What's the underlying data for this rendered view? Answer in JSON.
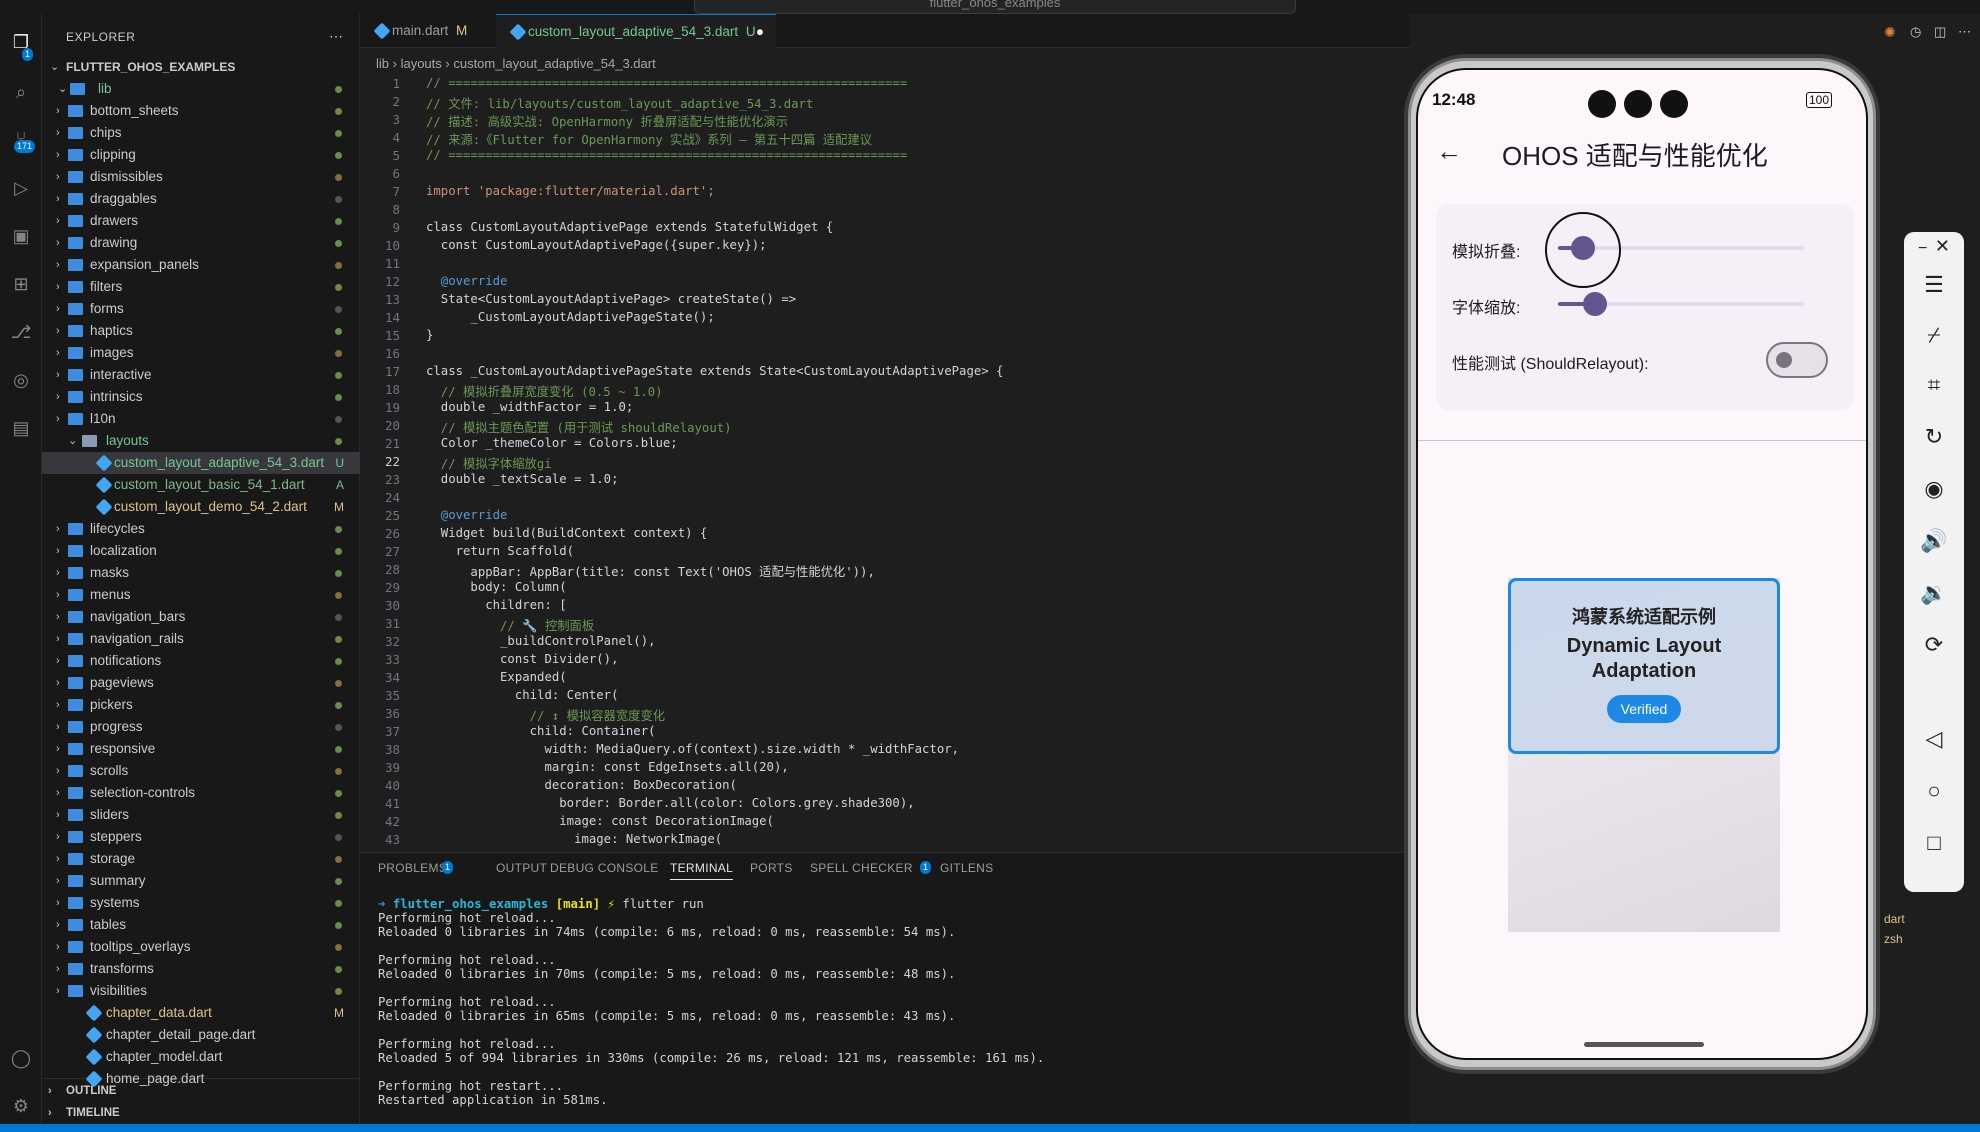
{
  "window": {
    "search_text": "flutter_ohos_examples"
  },
  "activity_bar": {
    "explorer_badge": "1",
    "scm_badge": "171"
  },
  "sidebar": {
    "title": "EXPLORER",
    "root": "FLUTTER_OHOS_EXAMPLES",
    "lib": "lib",
    "folders_top": [
      "bottom_sheets",
      "chips",
      "clipping",
      "dismissibles",
      "draggables",
      "drawers",
      "drawing",
      "expansion_panels",
      "filters",
      "forms",
      "haptics",
      "images",
      "interactive",
      "intrinsics",
      "l10n"
    ],
    "layouts": "layouts",
    "layout_files": [
      {
        "name": "custom_layout_adaptive_54_3.dart",
        "status": "U"
      },
      {
        "name": "custom_layout_basic_54_1.dart",
        "status": "A"
      },
      {
        "name": "custom_layout_demo_54_2.dart",
        "status": "M"
      }
    ],
    "folders_bottom": [
      "lifecycles",
      "localization",
      "masks",
      "menus",
      "navigation_bars",
      "navigation_rails",
      "notifications",
      "pageviews",
      "pickers",
      "progress",
      "responsive",
      "scrolls",
      "selection-controls",
      "sliders",
      "steppers",
      "storage",
      "summary",
      "systems",
      "tables",
      "tooltips_overlays",
      "transforms",
      "visibilities"
    ],
    "files": [
      {
        "name": "chapter_data.dart",
        "status": "M"
      },
      {
        "name": "chapter_detail_page.dart",
        "status": ""
      },
      {
        "name": "chapter_model.dart",
        "status": ""
      },
      {
        "name": "home_page.dart",
        "status": ""
      }
    ],
    "outline": "OUTLINE",
    "timeline": "TIMELINE"
  },
  "editor": {
    "tabs": [
      {
        "label": "main.dart",
        "status": "M"
      },
      {
        "label": "custom_layout_adaptive_54_3.dart",
        "status": "U"
      }
    ],
    "breadcrumb": [
      "lib",
      "layouts",
      "custom_layout_adaptive_54_3.dart"
    ],
    "lines": [
      "// ==============================================================",
      "// 文件: lib/layouts/custom_layout_adaptive_54_3.dart",
      "// 描述: 高级实战: OpenHarmony 折叠屏适配与性能优化演示",
      "// 来源:《Flutter for OpenHarmony 实战》系列 — 第五十四篇 适配建议",
      "// ==============================================================",
      "",
      "import 'package:flutter/material.dart';",
      "",
      "class CustomLayoutAdaptivePage extends StatefulWidget {",
      "  const CustomLayoutAdaptivePage({super.key});",
      "",
      "  @override",
      "  State<CustomLayoutAdaptivePage> createState() =>",
      "      _CustomLayoutAdaptivePageState();",
      "}",
      "",
      "class _CustomLayoutAdaptivePageState extends State<CustomLayoutAdaptivePage> {",
      "  // 模拟折叠屏宽度变化 (0.5 ~ 1.0)",
      "  double _widthFactor = 1.0;",
      "  // 模拟主题色配置 (用于测试 shouldRelayout)",
      "  Color _themeColor = Colors.blue;",
      "  // 模拟字体缩放gi",
      "  double _textScale = 1.0;",
      "",
      "  @override",
      "  Widget build(BuildContext context) {",
      "    return Scaffold(",
      "      appBar: AppBar(title: const Text('OHOS 适配与性能优化')),",
      "      body: Column(",
      "        children: [",
      "          // 🔧 控制面板",
      "          _buildControlPanel(),",
      "          const Divider(),",
      "          Expanded(",
      "            child: Center(",
      "              // ↕ 模拟容器宽度变化",
      "              child: Container(",
      "                width: MediaQuery.of(context).size.width * _widthFactor,",
      "                margin: const EdgeInsets.all(20),",
      "                decoration: BoxDecoration(",
      "                  border: Border.all(color: Colors.grey.shade300),",
      "                  image: const DecorationImage(",
      "                    image: NetworkImage("
    ]
  },
  "panel": {
    "tabs": [
      "PROBLEMS",
      "OUTPUT",
      "DEBUG CONSOLE",
      "TERMINAL",
      "PORTS",
      "SPELL CHECKER",
      "GITLENS"
    ],
    "problems_count": "1",
    "spell_count": "1",
    "prompt_dir": "flutter_ohos_examples",
    "prompt_branch": "[main]",
    "prompt_cmd": "flutter run",
    "output": [
      "Performing hot reload...",
      "Reloaded 0 libraries in 74ms (compile: 6 ms, reload: 0 ms, reassemble: 54 ms).",
      "",
      "Performing hot reload...",
      "Reloaded 0 libraries in 70ms (compile: 5 ms, reload: 0 ms, reassemble: 48 ms).",
      "",
      "Performing hot reload...",
      "Reloaded 0 libraries in 65ms (compile: 5 ms, reload: 0 ms, reassemble: 43 ms).",
      "",
      "Performing hot reload...",
      "Reloaded 5 of 994 libraries in 330ms (compile: 26 ms, reload: 121 ms, reassemble: 161 ms).",
      "",
      "Performing hot restart...",
      "Restarted application in 581ms."
    ]
  },
  "phone": {
    "time": "12:48",
    "battery": "100",
    "app_title": "OHOS 适配与性能优化",
    "fold_label": "模拟折叠:",
    "fold_value": 0.1,
    "scale_label": "字体缩放:",
    "scale_value": 0.15,
    "perf_label": "性能测试 (ShouldRelayout):",
    "perf_on": false,
    "card_title_cn": "鸿蒙系统适配示例",
    "card_title_en1": "Dynamic Layout",
    "card_title_en2": "Adaptation",
    "verified": "Verified"
  },
  "right_panel": {
    "item1": "dart",
    "item2": "zsh"
  }
}
